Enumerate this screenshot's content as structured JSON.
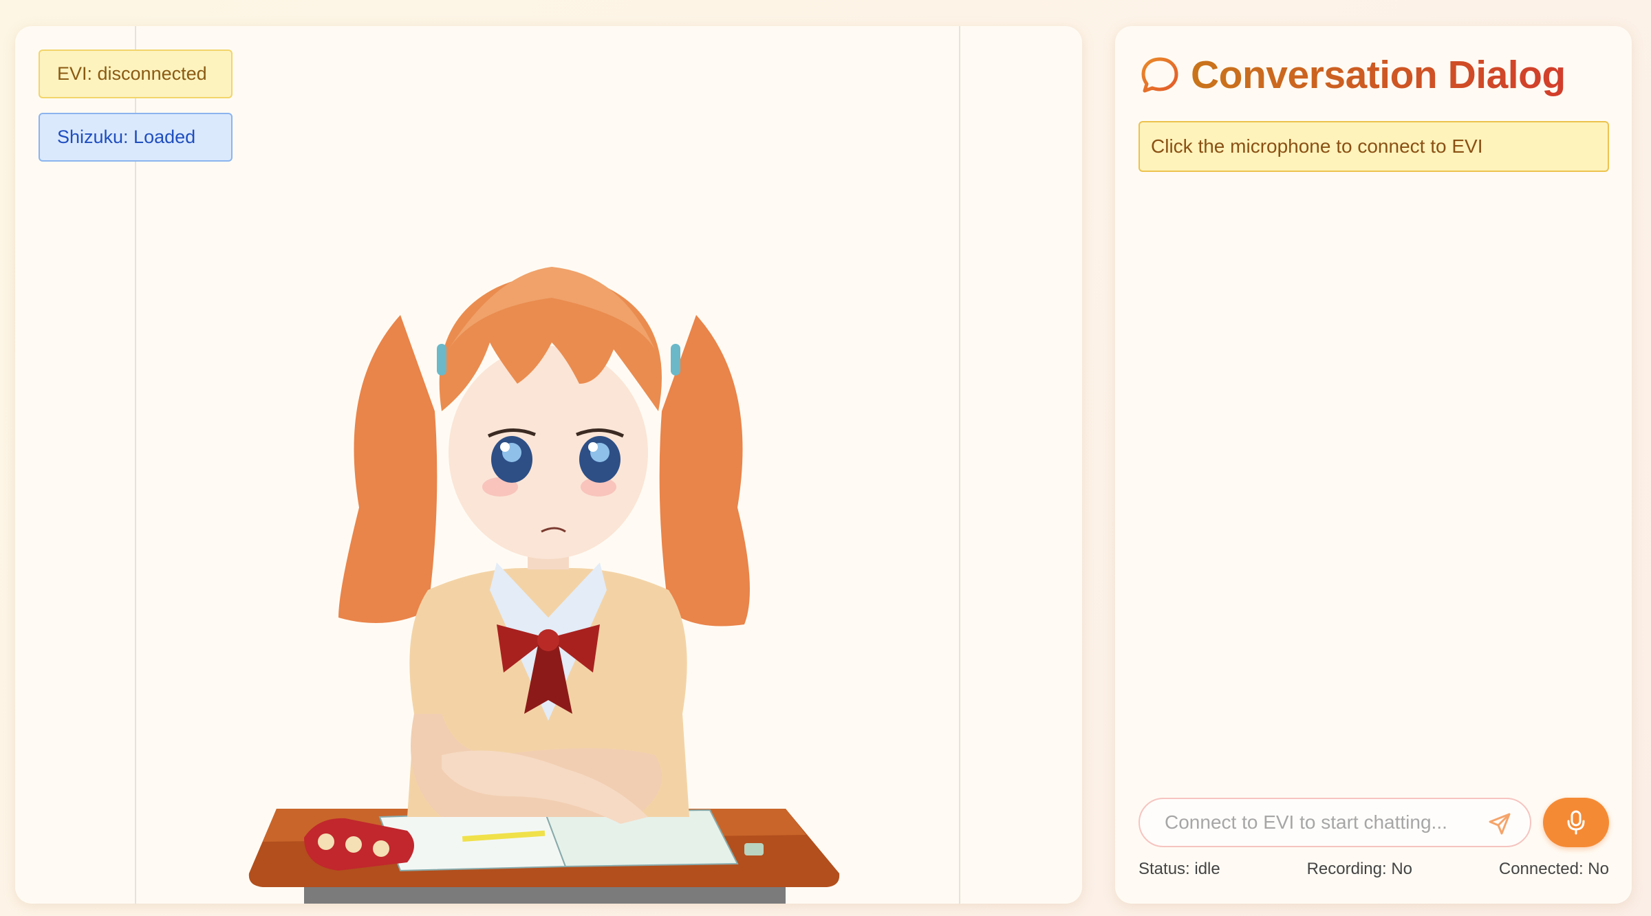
{
  "stage": {
    "evi_status": "EVI: disconnected",
    "model_status": "Shizuku: Loaded"
  },
  "dialog": {
    "title": "Conversation Dialog",
    "hint": "Click the microphone to connect to EVI",
    "input_placeholder": "Connect to EVI to start chatting...",
    "status": "Status: idle",
    "recording": "Recording: No",
    "connected": "Connected: No"
  },
  "colors": {
    "accent_orange": "#f58a35",
    "title_gradient_start": "#c9751b",
    "title_gradient_end": "#d23d2b",
    "hint_background": "#fdf3bb",
    "evi_badge_background": "#fdf3bf",
    "model_badge_background": "#dbe9fd"
  },
  "icons": {
    "title_icon": "chat-bubble-icon",
    "send_icon": "send-icon",
    "mic_icon": "microphone-icon"
  }
}
